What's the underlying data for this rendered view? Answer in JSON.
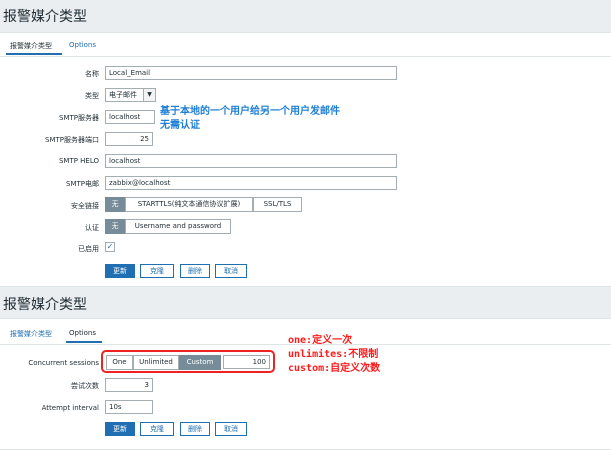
{
  "top": {
    "title": "报警媒介类型",
    "tabs": [
      "报警媒介类型",
      "Options"
    ],
    "fields": {
      "name_label": "名称",
      "name_value": "Local_Email",
      "type_label": "类型",
      "type_value": "电子邮件",
      "smtp_server_label": "SMTP服务器",
      "smtp_server_value": "localhost",
      "smtp_port_label": "SMTP服务器端口",
      "smtp_port_value": "25",
      "smtp_helo_label": "SMTP HELO",
      "smtp_helo_value": "localhost",
      "smtp_email_label": "SMTP电邮",
      "smtp_email_value": "zabbix@localhost",
      "security_label": "安全链接",
      "security_options": [
        "无",
        "STARTTLS(纯文本通信协议扩展)",
        "SSL/TLS"
      ],
      "auth_label": "认证",
      "auth_options": [
        "无",
        "Username and password"
      ],
      "enabled_label": "已启用"
    },
    "buttons": [
      "更新",
      "克隆",
      "删除",
      "取消"
    ],
    "note": [
      "基于本地的一个用户给另一个用户发邮件",
      "无需认证"
    ]
  },
  "bottom": {
    "title": "报警媒介类型",
    "tabs": [
      "报警媒介类型",
      "Options"
    ],
    "fields": {
      "concurrent_label": "Concurrent sessions",
      "concurrent_options": [
        "One",
        "Unlimited",
        "Custom"
      ],
      "concurrent_value": "100",
      "attempts_label": "尝试次数",
      "attempts_value": "3",
      "interval_label": "Attempt interval",
      "interval_value": "10s"
    },
    "buttons": [
      "更新",
      "克隆",
      "删除",
      "取消"
    ],
    "note": [
      "one:定义一次",
      "unlimites:不限制",
      "custom:自定义次数"
    ]
  },
  "colors": {
    "accent": "#1f6fb2",
    "selected": "#768d99",
    "annotation_blue": "#1e7fd6",
    "annotation_red": "#ff1a1a"
  }
}
